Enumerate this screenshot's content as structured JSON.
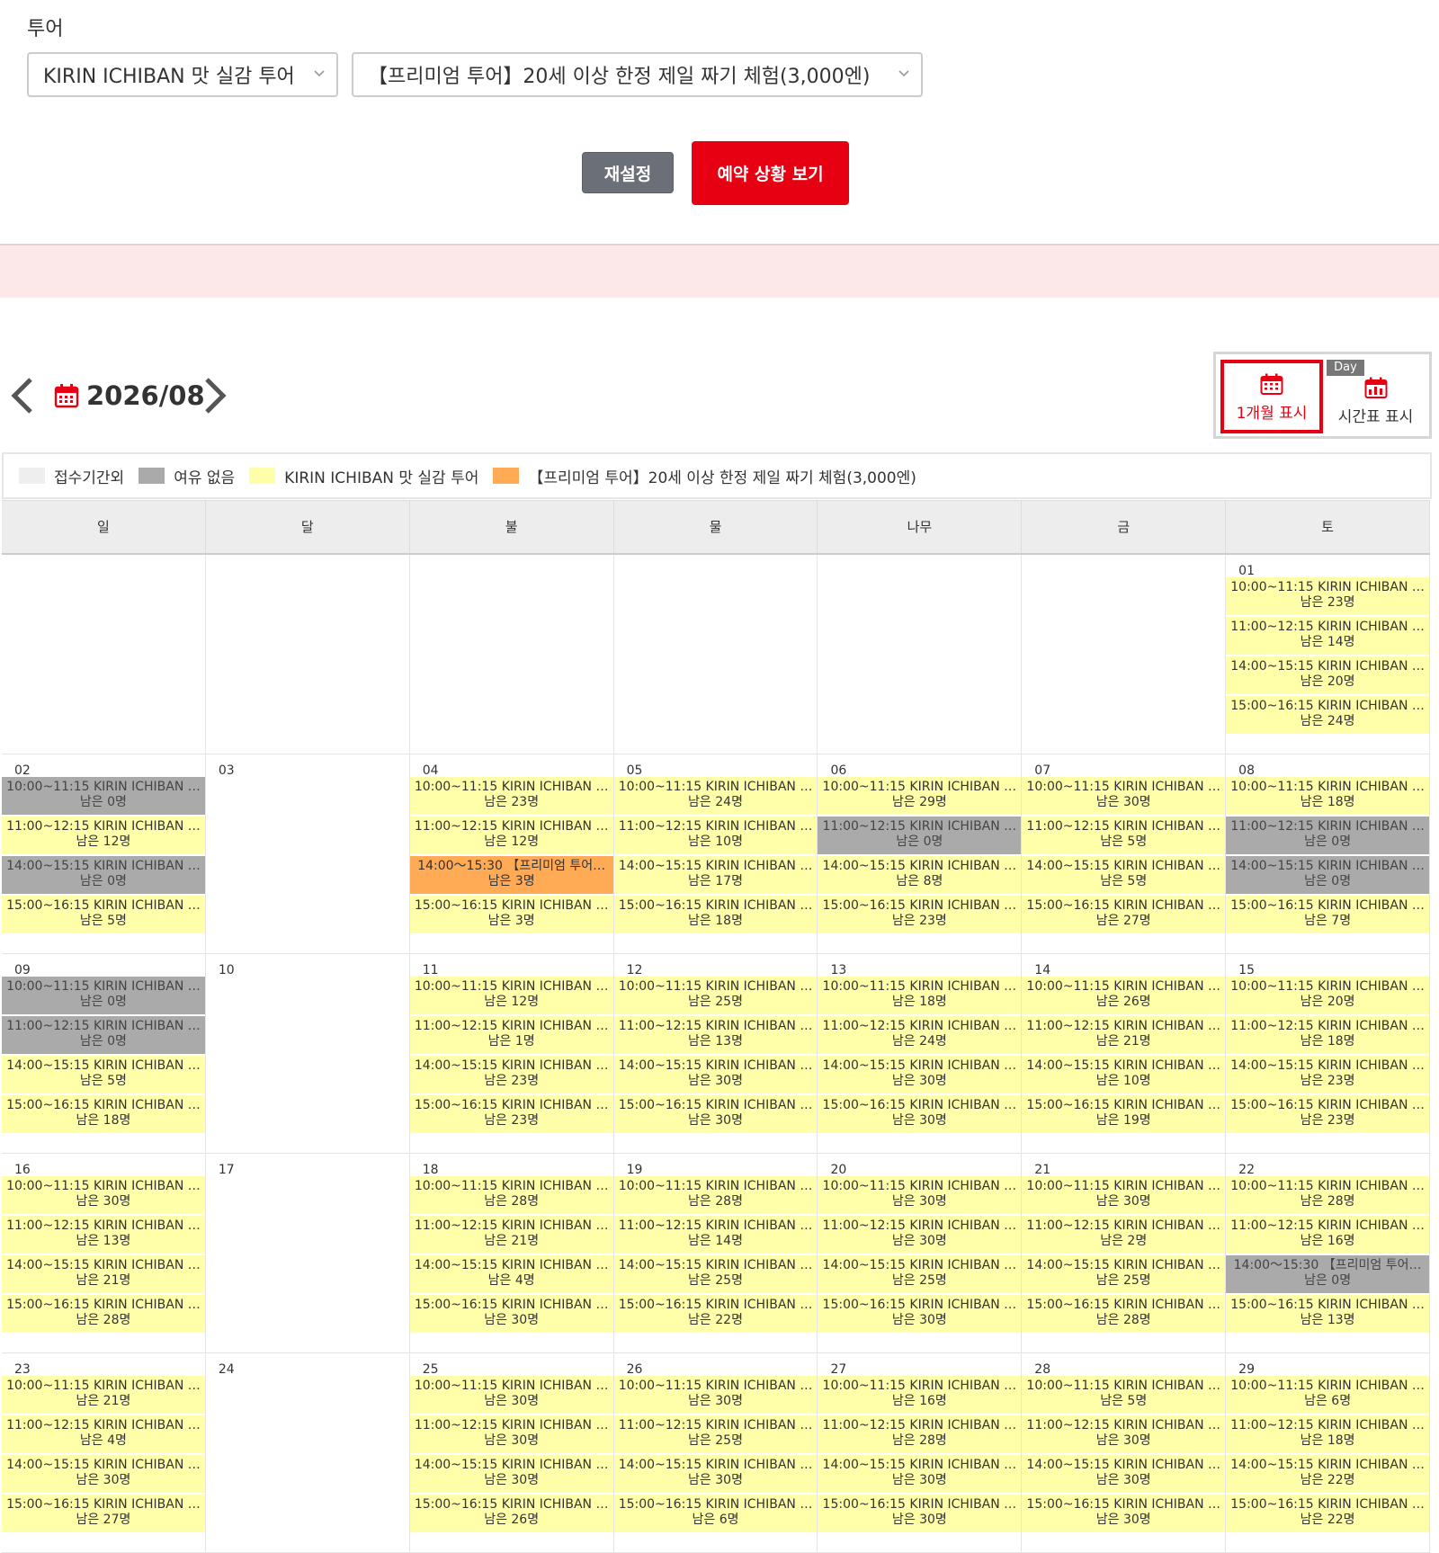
{
  "filters": {
    "label": "투어",
    "tour_select": "KIRIN ICHIBAN 맛 실감 투어",
    "course_select": "【프리미엄 투어】20세 이상 한정 제일 짜기 체험(3,000엔)",
    "reset_label": "재설정",
    "view_label": "예약 상황 보기"
  },
  "calendar": {
    "month": "2026/08",
    "view_month_label": "1개월 표시",
    "view_day_tag": "Day",
    "view_day_label": "시간표 표시",
    "legend": [
      {
        "label": "접수기간외",
        "color": "#eeeeee"
      },
      {
        "label": "여유 없음",
        "color": "#aaaaaa"
      },
      {
        "label": "KIRIN ICHIBAN 맛 실감 투어",
        "color": "#ffffaa"
      },
      {
        "label": "【프리미엄 투어】20세 이상 한정 제일 짜기 체험(3,000엔)",
        "color": "#ffaa55"
      }
    ],
    "weekdays": [
      "일",
      "달",
      "불",
      "물",
      "나무",
      "금",
      "토"
    ],
    "weeks": [
      [
        {
          "num": "",
          "slots": []
        },
        {
          "num": "",
          "slots": []
        },
        {
          "num": "",
          "slots": []
        },
        {
          "num": "",
          "slots": []
        },
        {
          "num": "",
          "slots": []
        },
        {
          "num": "",
          "slots": []
        },
        {
          "num": "01",
          "slots": [
            {
              "time": "10:00~11:15 KIRIN ICHIBAN …",
              "left": "남은 23명",
              "type": "y"
            },
            {
              "time": "11:00~12:15 KIRIN ICHIBAN …",
              "left": "남은 14명",
              "type": "y"
            },
            {
              "time": "14:00~15:15 KIRIN ICHIBAN …",
              "left": "남은 20명",
              "type": "y"
            },
            {
              "time": "15:00~16:15 KIRIN ICHIBAN …",
              "left": "남은 24명",
              "type": "y"
            }
          ]
        }
      ],
      [
        {
          "num": "02",
          "slots": [
            {
              "time": "10:00~11:15 KIRIN ICHIBAN …",
              "left": "남은 0명",
              "type": "g"
            },
            {
              "time": "11:00~12:15 KIRIN ICHIBAN …",
              "left": "남은 12명",
              "type": "y"
            },
            {
              "time": "14:00~15:15 KIRIN ICHIBAN …",
              "left": "남은 0명",
              "type": "g"
            },
            {
              "time": "15:00~16:15 KIRIN ICHIBAN …",
              "left": "남은 5명",
              "type": "y"
            }
          ]
        },
        {
          "num": "03",
          "slots": []
        },
        {
          "num": "04",
          "slots": [
            {
              "time": "10:00~11:15 KIRIN ICHIBAN …",
              "left": "남은 23명",
              "type": "y"
            },
            {
              "time": "11:00~12:15 KIRIN ICHIBAN …",
              "left": "남은 12명",
              "type": "y"
            },
            {
              "time": "14:00～15:30 【프리미엄 투어…",
              "left": "남은 3명",
              "type": "o"
            },
            {
              "time": "15:00~16:15 KIRIN ICHIBAN …",
              "left": "남은 3명",
              "type": "y"
            }
          ]
        },
        {
          "num": "05",
          "slots": [
            {
              "time": "10:00~11:15 KIRIN ICHIBAN …",
              "left": "남은 24명",
              "type": "y"
            },
            {
              "time": "11:00~12:15 KIRIN ICHIBAN …",
              "left": "남은 10명",
              "type": "y"
            },
            {
              "time": "14:00~15:15 KIRIN ICHIBAN …",
              "left": "남은 17명",
              "type": "y"
            },
            {
              "time": "15:00~16:15 KIRIN ICHIBAN …",
              "left": "남은 18명",
              "type": "y"
            }
          ]
        },
        {
          "num": "06",
          "slots": [
            {
              "time": "10:00~11:15 KIRIN ICHIBAN …",
              "left": "남은 29명",
              "type": "y"
            },
            {
              "time": "11:00~12:15 KIRIN ICHIBAN …",
              "left": "남은 0명",
              "type": "g"
            },
            {
              "time": "14:00~15:15 KIRIN ICHIBAN …",
              "left": "남은 8명",
              "type": "y"
            },
            {
              "time": "15:00~16:15 KIRIN ICHIBAN …",
              "left": "남은 23명",
              "type": "y"
            }
          ]
        },
        {
          "num": "07",
          "slots": [
            {
              "time": "10:00~11:15 KIRIN ICHIBAN …",
              "left": "남은 30명",
              "type": "y"
            },
            {
              "time": "11:00~12:15 KIRIN ICHIBAN …",
              "left": "남은 5명",
              "type": "y"
            },
            {
              "time": "14:00~15:15 KIRIN ICHIBAN …",
              "left": "남은 5명",
              "type": "y"
            },
            {
              "time": "15:00~16:15 KIRIN ICHIBAN …",
              "left": "남은 27명",
              "type": "y"
            }
          ]
        },
        {
          "num": "08",
          "slots": [
            {
              "time": "10:00~11:15 KIRIN ICHIBAN …",
              "left": "남은 18명",
              "type": "y"
            },
            {
              "time": "11:00~12:15 KIRIN ICHIBAN …",
              "left": "남은 0명",
              "type": "g"
            },
            {
              "time": "14:00~15:15 KIRIN ICHIBAN …",
              "left": "남은 0명",
              "type": "g"
            },
            {
              "time": "15:00~16:15 KIRIN ICHIBAN …",
              "left": "남은 7명",
              "type": "y"
            }
          ]
        }
      ],
      [
        {
          "num": "09",
          "slots": [
            {
              "time": "10:00~11:15 KIRIN ICHIBAN …",
              "left": "남은 0명",
              "type": "g"
            },
            {
              "time": "11:00~12:15 KIRIN ICHIBAN …",
              "left": "남은 0명",
              "type": "g"
            },
            {
              "time": "14:00~15:15 KIRIN ICHIBAN …",
              "left": "남은 5명",
              "type": "y"
            },
            {
              "time": "15:00~16:15 KIRIN ICHIBAN …",
              "left": "남은 18명",
              "type": "y"
            }
          ]
        },
        {
          "num": "10",
          "slots": []
        },
        {
          "num": "11",
          "slots": [
            {
              "time": "10:00~11:15 KIRIN ICHIBAN …",
              "left": "남은 12명",
              "type": "y"
            },
            {
              "time": "11:00~12:15 KIRIN ICHIBAN …",
              "left": "남은 1명",
              "type": "y"
            },
            {
              "time": "14:00~15:15 KIRIN ICHIBAN …",
              "left": "남은 23명",
              "type": "y"
            },
            {
              "time": "15:00~16:15 KIRIN ICHIBAN …",
              "left": "남은 23명",
              "type": "y"
            }
          ]
        },
        {
          "num": "12",
          "slots": [
            {
              "time": "10:00~11:15 KIRIN ICHIBAN …",
              "left": "남은 25명",
              "type": "y"
            },
            {
              "time": "11:00~12:15 KIRIN ICHIBAN …",
              "left": "남은 13명",
              "type": "y"
            },
            {
              "time": "14:00~15:15 KIRIN ICHIBAN …",
              "left": "남은 30명",
              "type": "y"
            },
            {
              "time": "15:00~16:15 KIRIN ICHIBAN …",
              "left": "남은 30명",
              "type": "y"
            }
          ]
        },
        {
          "num": "13",
          "slots": [
            {
              "time": "10:00~11:15 KIRIN ICHIBAN …",
              "left": "남은 18명",
              "type": "y"
            },
            {
              "time": "11:00~12:15 KIRIN ICHIBAN …",
              "left": "남은 24명",
              "type": "y"
            },
            {
              "time": "14:00~15:15 KIRIN ICHIBAN …",
              "left": "남은 30명",
              "type": "y"
            },
            {
              "time": "15:00~16:15 KIRIN ICHIBAN …",
              "left": "남은 30명",
              "type": "y"
            }
          ]
        },
        {
          "num": "14",
          "slots": [
            {
              "time": "10:00~11:15 KIRIN ICHIBAN …",
              "left": "남은 26명",
              "type": "y"
            },
            {
              "time": "11:00~12:15 KIRIN ICHIBAN …",
              "left": "남은 21명",
              "type": "y"
            },
            {
              "time": "14:00~15:15 KIRIN ICHIBAN …",
              "left": "남은 10명",
              "type": "y"
            },
            {
              "time": "15:00~16:15 KIRIN ICHIBAN …",
              "left": "남은 19명",
              "type": "y"
            }
          ]
        },
        {
          "num": "15",
          "slots": [
            {
              "time": "10:00~11:15 KIRIN ICHIBAN …",
              "left": "남은 20명",
              "type": "y"
            },
            {
              "time": "11:00~12:15 KIRIN ICHIBAN …",
              "left": "남은 18명",
              "type": "y"
            },
            {
              "time": "14:00~15:15 KIRIN ICHIBAN …",
              "left": "남은 23명",
              "type": "y"
            },
            {
              "time": "15:00~16:15 KIRIN ICHIBAN …",
              "left": "남은 23명",
              "type": "y"
            }
          ]
        }
      ],
      [
        {
          "num": "16",
          "slots": [
            {
              "time": "10:00~11:15 KIRIN ICHIBAN …",
              "left": "남은 30명",
              "type": "y"
            },
            {
              "time": "11:00~12:15 KIRIN ICHIBAN …",
              "left": "남은 13명",
              "type": "y"
            },
            {
              "time": "14:00~15:15 KIRIN ICHIBAN …",
              "left": "남은 21명",
              "type": "y"
            },
            {
              "time": "15:00~16:15 KIRIN ICHIBAN …",
              "left": "남은 28명",
              "type": "y"
            }
          ]
        },
        {
          "num": "17",
          "slots": []
        },
        {
          "num": "18",
          "slots": [
            {
              "time": "10:00~11:15 KIRIN ICHIBAN …",
              "left": "남은 28명",
              "type": "y"
            },
            {
              "time": "11:00~12:15 KIRIN ICHIBAN …",
              "left": "남은 21명",
              "type": "y"
            },
            {
              "time": "14:00~15:15 KIRIN ICHIBAN …",
              "left": "남은 4명",
              "type": "y"
            },
            {
              "time": "15:00~16:15 KIRIN ICHIBAN …",
              "left": "남은 30명",
              "type": "y"
            }
          ]
        },
        {
          "num": "19",
          "slots": [
            {
              "time": "10:00~11:15 KIRIN ICHIBAN …",
              "left": "남은 28명",
              "type": "y"
            },
            {
              "time": "11:00~12:15 KIRIN ICHIBAN …",
              "left": "남은 14명",
              "type": "y"
            },
            {
              "time": "14:00~15:15 KIRIN ICHIBAN …",
              "left": "남은 25명",
              "type": "y"
            },
            {
              "time": "15:00~16:15 KIRIN ICHIBAN …",
              "left": "남은 22명",
              "type": "y"
            }
          ]
        },
        {
          "num": "20",
          "slots": [
            {
              "time": "10:00~11:15 KIRIN ICHIBAN …",
              "left": "남은 30명",
              "type": "y"
            },
            {
              "time": "11:00~12:15 KIRIN ICHIBAN …",
              "left": "남은 30명",
              "type": "y"
            },
            {
              "time": "14:00~15:15 KIRIN ICHIBAN …",
              "left": "남은 25명",
              "type": "y"
            },
            {
              "time": "15:00~16:15 KIRIN ICHIBAN …",
              "left": "남은 30명",
              "type": "y"
            }
          ]
        },
        {
          "num": "21",
          "slots": [
            {
              "time": "10:00~11:15 KIRIN ICHIBAN …",
              "left": "남은 30명",
              "type": "y"
            },
            {
              "time": "11:00~12:15 KIRIN ICHIBAN …",
              "left": "남은 2명",
              "type": "y"
            },
            {
              "time": "14:00~15:15 KIRIN ICHIBAN …",
              "left": "남은 25명",
              "type": "y"
            },
            {
              "time": "15:00~16:15 KIRIN ICHIBAN …",
              "left": "남은 28명",
              "type": "y"
            }
          ]
        },
        {
          "num": "22",
          "slots": [
            {
              "time": "10:00~11:15 KIRIN ICHIBAN …",
              "left": "남은 28명",
              "type": "y"
            },
            {
              "time": "11:00~12:15 KIRIN ICHIBAN …",
              "left": "남은 16명",
              "type": "y"
            },
            {
              "time": "14:00～15:30 【프리미엄 투어…",
              "left": "남은 0명",
              "type": "g"
            },
            {
              "time": "15:00~16:15 KIRIN ICHIBAN …",
              "left": "남은 13명",
              "type": "y"
            }
          ]
        }
      ],
      [
        {
          "num": "23",
          "slots": [
            {
              "time": "10:00~11:15 KIRIN ICHIBAN …",
              "left": "남은 21명",
              "type": "y"
            },
            {
              "time": "11:00~12:15 KIRIN ICHIBAN …",
              "left": "남은 4명",
              "type": "y"
            },
            {
              "time": "14:00~15:15 KIRIN ICHIBAN …",
              "left": "남은 30명",
              "type": "y"
            },
            {
              "time": "15:00~16:15 KIRIN ICHIBAN …",
              "left": "남은 27명",
              "type": "y"
            }
          ]
        },
        {
          "num": "24",
          "slots": []
        },
        {
          "num": "25",
          "slots": [
            {
              "time": "10:00~11:15 KIRIN ICHIBAN …",
              "left": "남은 30명",
              "type": "y"
            },
            {
              "time": "11:00~12:15 KIRIN ICHIBAN …",
              "left": "남은 30명",
              "type": "y"
            },
            {
              "time": "14:00~15:15 KIRIN ICHIBAN …",
              "left": "남은 30명",
              "type": "y"
            },
            {
              "time": "15:00~16:15 KIRIN ICHIBAN …",
              "left": "남은 26명",
              "type": "y"
            }
          ]
        },
        {
          "num": "26",
          "slots": [
            {
              "time": "10:00~11:15 KIRIN ICHIBAN …",
              "left": "남은 30명",
              "type": "y"
            },
            {
              "time": "11:00~12:15 KIRIN ICHIBAN …",
              "left": "남은 25명",
              "type": "y"
            },
            {
              "time": "14:00~15:15 KIRIN ICHIBAN …",
              "left": "남은 30명",
              "type": "y"
            },
            {
              "time": "15:00~16:15 KIRIN ICHIBAN …",
              "left": "남은 6명",
              "type": "y"
            }
          ]
        },
        {
          "num": "27",
          "slots": [
            {
              "time": "10:00~11:15 KIRIN ICHIBAN …",
              "left": "남은 16명",
              "type": "y"
            },
            {
              "time": "11:00~12:15 KIRIN ICHIBAN …",
              "left": "남은 28명",
              "type": "y"
            },
            {
              "time": "14:00~15:15 KIRIN ICHIBAN …",
              "left": "남은 30명",
              "type": "y"
            },
            {
              "time": "15:00~16:15 KIRIN ICHIBAN …",
              "left": "남은 30명",
              "type": "y"
            }
          ]
        },
        {
          "num": "28",
          "slots": [
            {
              "time": "10:00~11:15 KIRIN ICHIBAN …",
              "left": "남은 5명",
              "type": "y"
            },
            {
              "time": "11:00~12:15 KIRIN ICHIBAN …",
              "left": "남은 30명",
              "type": "y"
            },
            {
              "time": "14:00~15:15 KIRIN ICHIBAN …",
              "left": "남은 30명",
              "type": "y"
            },
            {
              "time": "15:00~16:15 KIRIN ICHIBAN …",
              "left": "남은 30명",
              "type": "y"
            }
          ]
        },
        {
          "num": "29",
          "slots": [
            {
              "time": "10:00~11:15 KIRIN ICHIBAN …",
              "left": "남은 6명",
              "type": "y"
            },
            {
              "time": "11:00~12:15 KIRIN ICHIBAN …",
              "left": "남은 18명",
              "type": "y"
            },
            {
              "time": "14:00~15:15 KIRIN ICHIBAN …",
              "left": "남은 22명",
              "type": "y"
            },
            {
              "time": "15:00~16:15 KIRIN ICHIBAN …",
              "left": "남은 22명",
              "type": "y"
            }
          ]
        }
      ]
    ]
  }
}
